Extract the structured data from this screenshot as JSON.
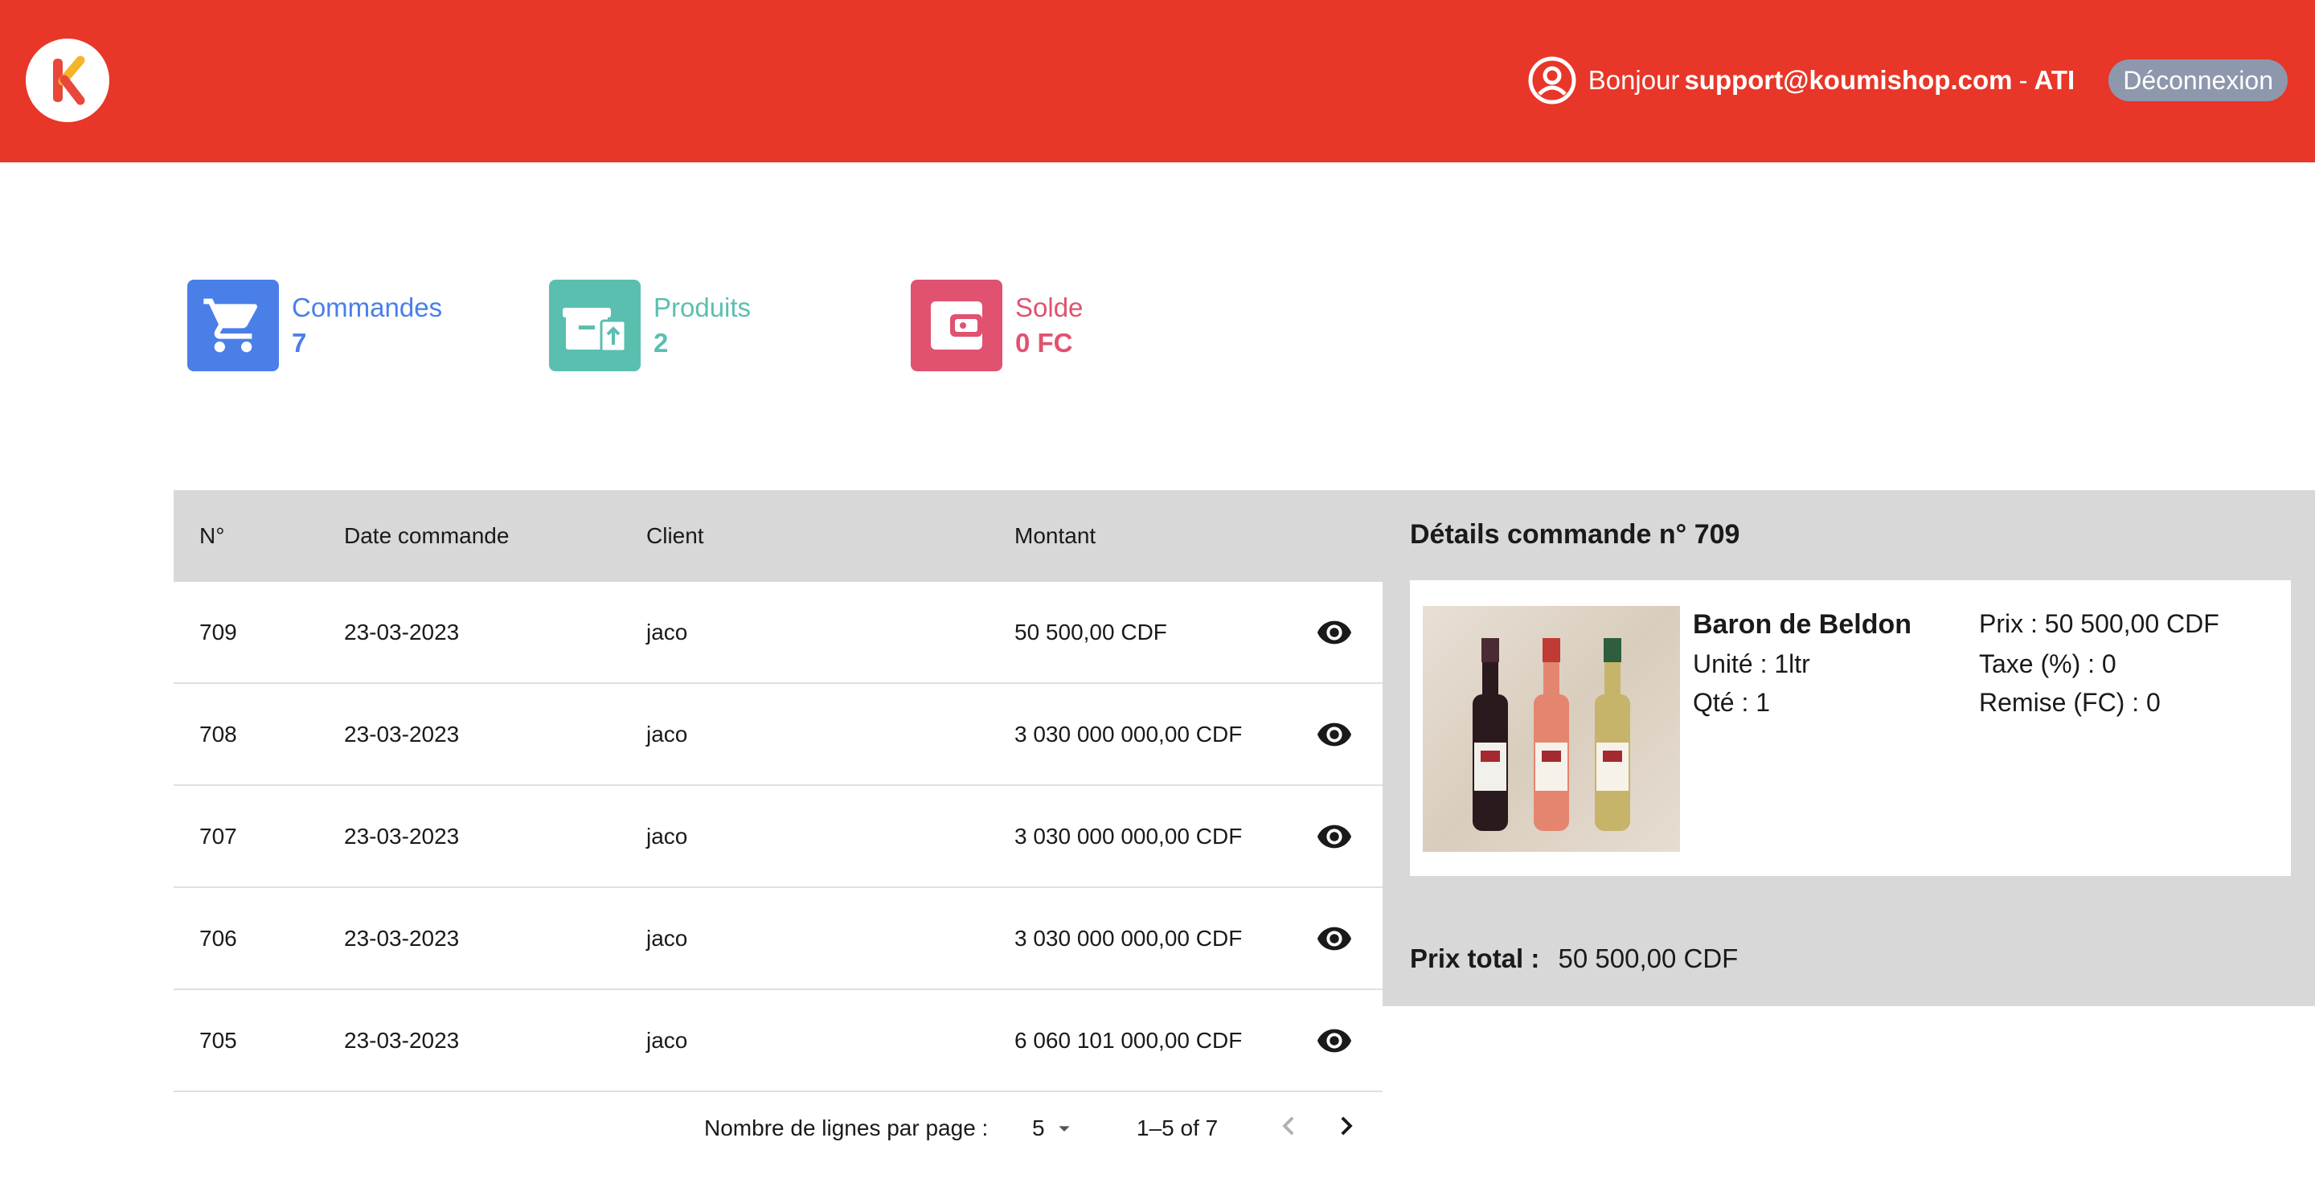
{
  "header": {
    "logo_letter": "K",
    "greeting": "Bonjour",
    "email": "support@koumishop.com",
    "separator": "-",
    "role": "ATI",
    "logout_label": "Déconnexion"
  },
  "stats": [
    {
      "label": "Commandes",
      "value": "7",
      "color": "#4a7fe8",
      "icon": "cart-icon"
    },
    {
      "label": "Produits",
      "value": "2",
      "color": "#5bbfb0",
      "icon": "product-box-icon"
    },
    {
      "label": "Solde",
      "value": "0 FC",
      "color": "#e05270",
      "icon": "wallet-icon"
    }
  ],
  "table": {
    "columns": [
      "N°",
      "Date commande",
      "Client",
      "Montant"
    ],
    "rows": [
      {
        "num": "709",
        "date": "23-03-2023",
        "client": "jaco",
        "amount": "50 500,00 CDF"
      },
      {
        "num": "708",
        "date": "23-03-2023",
        "client": "jaco",
        "amount": "3 030 000 000,00 CDF"
      },
      {
        "num": "707",
        "date": "23-03-2023",
        "client": "jaco",
        "amount": "3 030 000 000,00 CDF"
      },
      {
        "num": "706",
        "date": "23-03-2023",
        "client": "jaco",
        "amount": "3 030 000 000,00 CDF"
      },
      {
        "num": "705",
        "date": "23-03-2023",
        "client": "jaco",
        "amount": "6 060 101 000,00 CDF"
      }
    ]
  },
  "pagination": {
    "rows_label": "Nombre de lignes par page :",
    "rows_value": "5",
    "range": "1–5 of 7"
  },
  "details": {
    "title": "Détails commande n° 709",
    "product": {
      "name": "Baron de Beldon",
      "unit": "Unité : 1ltr",
      "qty": "Qté : 1",
      "price": "Prix : 50 500,00 CDF",
      "tax": "Taxe (%) : 0",
      "discount": "Remise (FC) : 0"
    },
    "total_label": "Prix total :",
    "total_value": "50 500,00 CDF"
  },
  "colors": {
    "header_bg": "#e83628",
    "logout_bg": "#8e98ad",
    "table_header_bg": "#d8d8d8"
  }
}
